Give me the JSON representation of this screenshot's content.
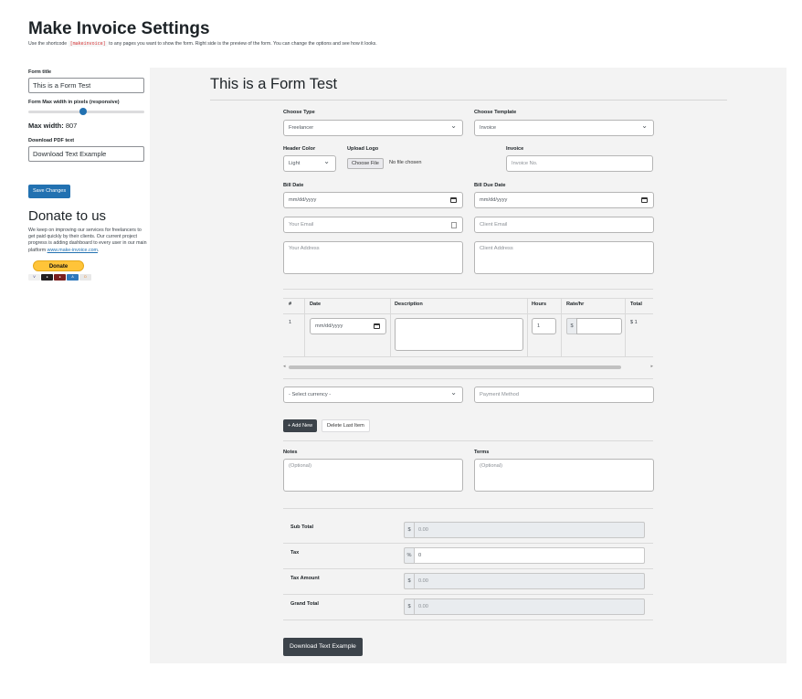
{
  "header": {
    "title": "Make Invoice Settings",
    "desc_prefix": "Use the shortcode",
    "shortcode": "[makeinvoice]",
    "desc_suffix": "to any pages you want to show the form. Right side is the preview of the form. You can change the options and see how it looks."
  },
  "settings": {
    "form_title_label": "Form title",
    "form_title_value": "This is a Form Test",
    "max_width_label": "Form Max width in pixels (responsive)",
    "max_width_prefix": "Max width:",
    "max_width_value": "807",
    "slider_fraction": 0.47,
    "pdf_text_label": "Download PDF text",
    "pdf_text_value": "Download Text Example",
    "save_label": "Save Changes"
  },
  "donate": {
    "title": "Donate to us",
    "text": "We keep on improving our services for freelancers to get paid quickly by their clients. Our current project progress is adding dashboard to every user in our main platform",
    "link": "www.make-invoice.com",
    "link_suffix": ".",
    "paypal_label": "Donate"
  },
  "preview": {
    "form_title": "This is a Form Test",
    "choose_type_label": "Choose Type",
    "choose_type_value": "Freelancer",
    "choose_template_label": "Choose Template",
    "choose_template_value": "Invoice",
    "header_color_label": "Header Color",
    "header_color_value": "Light",
    "upload_logo_label": "Upload Logo",
    "choose_file_label": "Choose File",
    "no_file_text": "No file chosen",
    "invoice_label": "Invoice",
    "invoice_placeholder": "Invoice No.",
    "bill_date_label": "Bill Date",
    "bill_date_placeholder": "mm/dd/yyyy",
    "bill_due_label": "Bill Due Date",
    "bill_due_placeholder": "mm/dd/yyyy",
    "your_email_placeholder": "Your Email",
    "client_email_placeholder": "Client Email",
    "your_address_placeholder": "Your Address",
    "client_address_placeholder": "Client Address",
    "items": {
      "headers": [
        "#",
        "Date",
        "Description",
        "Hours",
        "Rate/hr",
        "Total"
      ],
      "row_number": "1",
      "date_placeholder": "mm/dd/yyyy",
      "hours_value": "1",
      "rate_currency": "$",
      "total_value": "$ 1"
    },
    "currency_value": "- Select currency -",
    "payment_method_placeholder": "Payment Method",
    "add_new_label": "+ Add New",
    "delete_last_label": "Delete Last Item",
    "notes_label": "Notes",
    "notes_placeholder": "(Optional)",
    "terms_label": "Terms",
    "terms_placeholder": "(Optional)",
    "totals": {
      "sub_total_label": "Sub Total",
      "sub_total_symbol": "$",
      "sub_total_value": "0.00",
      "tax_label": "Tax",
      "tax_symbol": "%",
      "tax_value": "0",
      "tax_amount_label": "Tax Amount",
      "tax_amount_symbol": "$",
      "tax_amount_value": "0.00",
      "grand_total_label": "Grand Total",
      "grand_total_symbol": "$",
      "grand_total_value": "0.00"
    },
    "download_label": "Download Text Example"
  },
  "colors": {
    "accent": "#2271b1",
    "dark_button": "#3c434a",
    "paypal": "#ffc439"
  }
}
